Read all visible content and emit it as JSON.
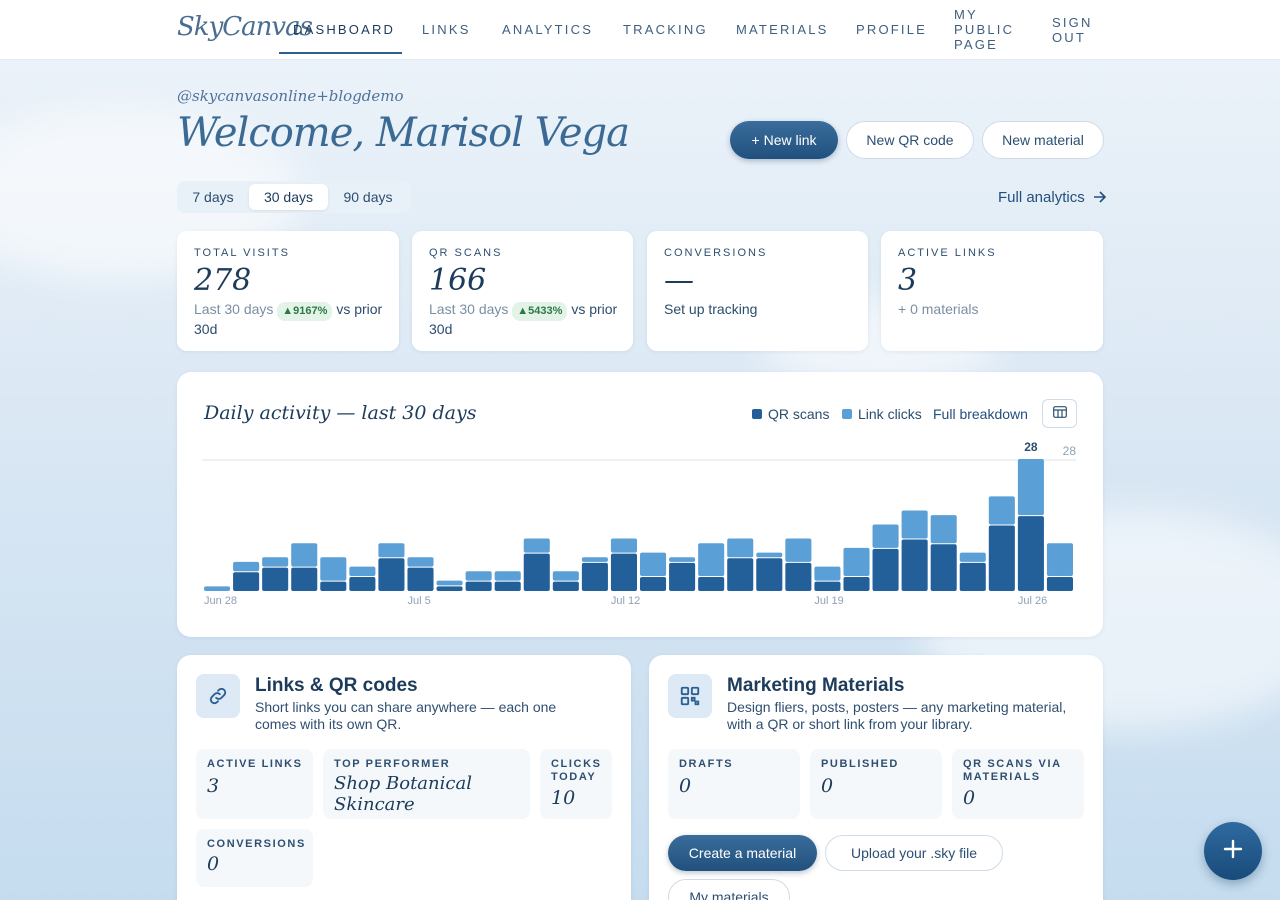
{
  "nav": {
    "logo": "SkyCanvas",
    "items": [
      "Dashboard",
      "Links",
      "Analytics",
      "Tracking",
      "Materials",
      "Profile",
      "My Public Page",
      "Sign Out"
    ],
    "active": "Dashboard"
  },
  "header": {
    "handle": "@skycanvasonline+blogdemo",
    "welcome": "Welcome, Marisol Vega",
    "new_link": "+ New link",
    "new_qr": "New QR code",
    "new_material": "New material"
  },
  "range": {
    "options": [
      "7 days",
      "30 days",
      "90 days"
    ],
    "selected": "30 days",
    "full_analytics": "Full analytics"
  },
  "stats": [
    {
      "label": "Total visits",
      "value": "278",
      "sub_prefix": "Last 30 days",
      "pct": "▲9167%",
      "sub_suffix": "vs prior 30d"
    },
    {
      "label": "QR scans",
      "value": "166",
      "sub_prefix": "Last 30 days",
      "pct": "▲5433%",
      "sub_suffix": "vs prior 30d"
    },
    {
      "label": "Conversions",
      "value": "—",
      "sub": "Set up tracking"
    },
    {
      "label": "Active links",
      "value": "3",
      "sub": "+ 0 materials"
    }
  ],
  "chart": {
    "title": "Daily activity — last 30 days",
    "legend_qr": "QR scans",
    "legend_link": "Link clicks",
    "full_breakdown": "Full breakdown",
    "max_label": "28",
    "peak_label": "28",
    "colors": {
      "qr": "#23609a",
      "link": "#5a9fd6"
    }
  },
  "chart_data": {
    "type": "bar",
    "stacked": true,
    "categories": [
      "Jun 28",
      "Jun 29",
      "Jun 30",
      "Jul 1",
      "Jul 2",
      "Jul 3",
      "Jul 4",
      "Jul 5",
      "Jul 6",
      "Jul 7",
      "Jul 8",
      "Jul 9",
      "Jul 10",
      "Jul 11",
      "Jul 12",
      "Jul 13",
      "Jul 14",
      "Jul 15",
      "Jul 16",
      "Jul 17",
      "Jul 18",
      "Jul 19",
      "Jul 20",
      "Jul 21",
      "Jul 22",
      "Jul 23",
      "Jul 24",
      "Jul 25",
      "Jul 26",
      "Jul 27"
    ],
    "x_tick_labels": [
      "Jun 28",
      "Jul 5",
      "Jul 12",
      "Jul 19",
      "Jul 26"
    ],
    "series": [
      {
        "name": "QR scans",
        "values": [
          0,
          4,
          5,
          5,
          2,
          3,
          7,
          5,
          1,
          2,
          2,
          8,
          2,
          6,
          8,
          3,
          6,
          3,
          7,
          7,
          6,
          2,
          3,
          9,
          11,
          10,
          6,
          14,
          16,
          3
        ]
      },
      {
        "name": "Link clicks",
        "values": [
          1,
          2,
          2,
          5,
          5,
          2,
          3,
          2,
          1,
          2,
          2,
          3,
          2,
          1,
          3,
          5,
          1,
          7,
          4,
          1,
          5,
          3,
          6,
          5,
          6,
          6,
          2,
          6,
          12,
          7
        ]
      }
    ],
    "ylim": [
      0,
      28
    ]
  },
  "links_panel": {
    "title": "Links & QR codes",
    "desc": "Short links you can share anywhere — each one comes with its own QR.",
    "active_links_label": "Active links",
    "active_links": "3",
    "top_performer_label": "Top performer",
    "top_performer": "Shop Botanical Skincare",
    "clicks_today_label": "Clicks today",
    "clicks_today": "10",
    "conversions_label": "Conversions",
    "conversions": "0"
  },
  "materials_panel": {
    "title": "Marketing Materials",
    "desc": "Design fliers, posts, posters — any marketing material, with a QR or short link from your library.",
    "drafts_label": "Drafts",
    "drafts": "0",
    "published_label": "Published",
    "published": "0",
    "qr_scans_label": "QR scans via materials",
    "qr_scans": "0",
    "create": "Create a material",
    "upload": "Upload your .sky file",
    "my_materials": "My materials"
  }
}
